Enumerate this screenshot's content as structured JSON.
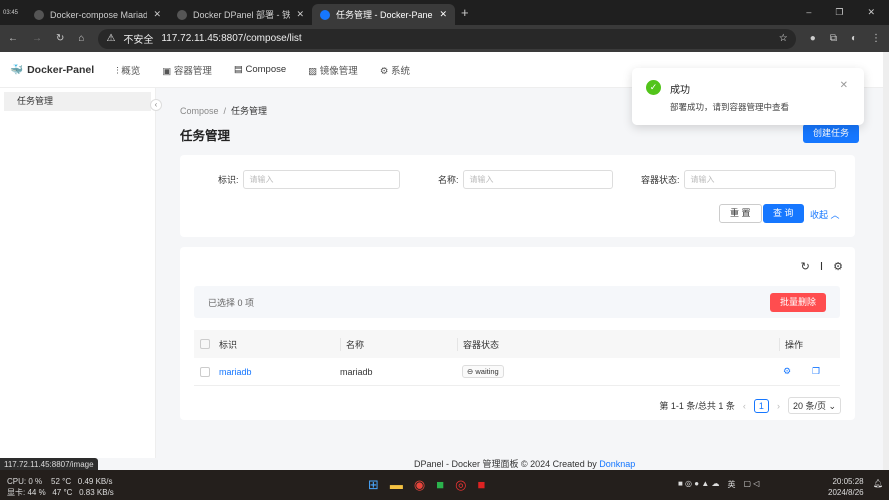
{
  "browser": {
    "tabs": [
      {
        "title": "Docker-compose Mariadb 部"
      },
      {
        "title": "Docker DPanel 部署 - 铁马冰"
      },
      {
        "title": "任务管理 - Docker-Panel"
      }
    ],
    "insecure": "不安全",
    "url": "117.72.11.45:8807/compose/list",
    "clock": "03:45"
  },
  "app": {
    "logo": "Docker-Panel",
    "nav": [
      "概览",
      "容器管理",
      "Compose",
      "镜像管理",
      "系统"
    ]
  },
  "sidebar": {
    "items": [
      "任务管理"
    ]
  },
  "page": {
    "breadcrumb": [
      "Compose",
      "任务管理"
    ],
    "title": "任务管理",
    "create": "创建任务"
  },
  "filters": {
    "fields": [
      {
        "label": "标识:",
        "placeholder": "请输入"
      },
      {
        "label": "名称:",
        "placeholder": "请输入"
      },
      {
        "label": "容器状态:",
        "placeholder": "请输入"
      }
    ],
    "reset": "重 置",
    "query": "查 询",
    "collapse": "收起"
  },
  "table": {
    "selected": "已选择  0  项",
    "batch_delete": "批量删除",
    "columns": [
      "标识",
      "名称",
      "容器状态",
      "操作"
    ],
    "rows": [
      {
        "id": "mariadb",
        "name": "mariadb",
        "status": "waiting"
      }
    ],
    "pager": {
      "summary": "第 1-1 条/总共 1 条",
      "page": "1",
      "size": "20 条/页"
    }
  },
  "toast": {
    "title": "成功",
    "message": "部署成功，请到容器管理中查看"
  },
  "footer": {
    "text": "DPanel - Docker 管理面板 © 2024 Created by",
    "link": "Donknap"
  },
  "status_url": "117.72.11.45:8807/image",
  "taskbar": {
    "line1": "CPU: 0 %    52 °C   0.49 KB/s",
    "line2": "显卡: 44 %   47 °C   0.83 KB/s",
    "ime": "英",
    "time": "20:05:28",
    "date": "2024/8/26"
  },
  "colors": {
    "primary": "#1677ff",
    "danger": "#ff4d4f",
    "success": "#52c41a"
  }
}
